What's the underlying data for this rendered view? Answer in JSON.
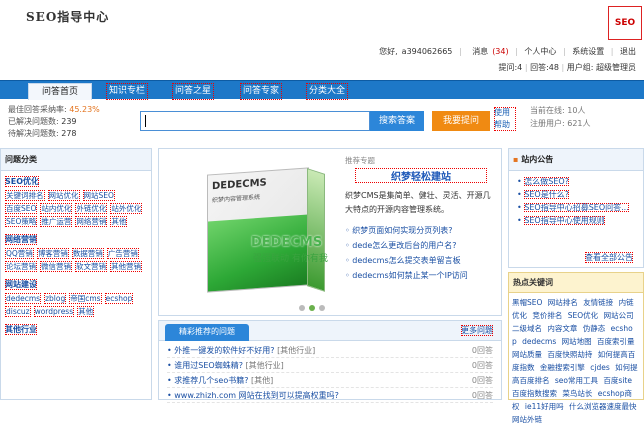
{
  "header": {
    "logo": "SEO指导中心",
    "brand_badge": "SEO",
    "welcome": "您好,",
    "username": "a394062665",
    "messages_label": "消息",
    "messages_count": "(34)",
    "personal_center": "个人中心",
    "system_settings": "系统设置",
    "logout": "退出",
    "questions": "提问:4",
    "answers": "回答:48",
    "user_group": "用户组: 超级管理员"
  },
  "nav": {
    "tabs": [
      "问答首页",
      "知识专栏",
      "问答之星",
      "问答专家",
      "分类大全"
    ]
  },
  "stats": {
    "best_rate_label": "最佳回答采纳率:",
    "best_rate": "45.23%",
    "solved_label": "已解决问题数:",
    "solved": "239",
    "pending_label": "待解决问题数:",
    "pending": "278"
  },
  "search": {
    "placeholder": "",
    "search_button": "搜索答案",
    "ask_button": "我要提问",
    "help_link": "使用帮助"
  },
  "online": {
    "online_label": "当前在线:",
    "online": "10人",
    "registered_label": "注册用户:",
    "registered": "621人"
  },
  "left": {
    "title": "问题分类",
    "categories": [
      {
        "name": "SEO优化",
        "links": [
          "关键词排名",
          "网站优化",
          "网站SEO",
          "百度SEO",
          "站内优化",
          "外链优化",
          "站外优化",
          "SEO策略",
          "推广运营",
          "网络营销",
          "其他"
        ]
      },
      {
        "name": "网络营销",
        "links": [
          "QQ营销",
          "博客营销",
          "数据营销",
          "广告营销",
          "论坛营销",
          "微信营销",
          "软文营销",
          "其他营销"
        ]
      },
      {
        "name": "网站建设",
        "links": [
          "dedecms",
          "zblog",
          "帝国cms",
          "ecshop",
          "discuz",
          "wordpress",
          "其他"
        ]
      },
      {
        "name": "其他行业",
        "links": []
      }
    ]
  },
  "slider": {
    "box_title": "DEDECMS",
    "box_subtitle": "织梦内容管理系统",
    "big_text": "DEDECMS",
    "slogan": "强强联动 有你有我",
    "tag": "推荐专题",
    "title": "织梦轻松建站",
    "description": "织梦CMS是集简单、健壮、灵活、开源几大特点的开源内容管理系统。",
    "links": [
      "织梦页面如何实现分页列表?",
      "dede怎么更改后台的用户名?",
      "dedecms怎么提交表单留言板",
      "dedecms如何禁止某一个IP访问"
    ]
  },
  "recommend": {
    "tab": "精彩推荐的问题",
    "more": "更多问题",
    "rows": [
      {
        "q": "外推一键发的软件好不好用?",
        "c": "[其他行业]",
        "n": "0回答"
      },
      {
        "q": "谁用过SEO蜘蛛精?",
        "c": "[其他行业]",
        "n": "0回答"
      },
      {
        "q": "求推荐几个seo书籍?",
        "c": "[其他]",
        "n": "0回答"
      },
      {
        "q": "www.zhizh.com 网站在找到可以提高权重吗?",
        "c": "",
        "n": "0回答"
      }
    ]
  },
  "notice": {
    "title": "站内公告",
    "items": [
      "怎么做SEO?",
      "SEO是什么?",
      "SEO指导中心招募SEO问答...",
      "SEO指导中心使用规则"
    ],
    "more": "查看全部公告"
  },
  "hot": {
    "title": "热点关键词",
    "keywords": [
      "黑帽SEO",
      "网站排名",
      "友情链接",
      "内链优化",
      "竞价排名",
      "SEO优化",
      "网站公司",
      "二级域名",
      "内容文章",
      "伪静态",
      "ecshop",
      "dedecms",
      "网站地图",
      "百度索引量",
      "网站质量",
      "百度快照劫持",
      "如何提高百度指数",
      "金融搜索引擎",
      "cjdes",
      "如何提高百度排名",
      "seo常用工具",
      "百度site",
      "百度指数搜索",
      "菜鸟站长",
      "ecshop商权",
      "ie11好用吗",
      "什么浏览器速度最快",
      "网站外链"
    ]
  },
  "colors": {
    "nav_blue": "#1d78c8",
    "search_blue": "#2c86d9",
    "ask_orange": "#f08a12",
    "link_blue": "#1a4fa3"
  }
}
